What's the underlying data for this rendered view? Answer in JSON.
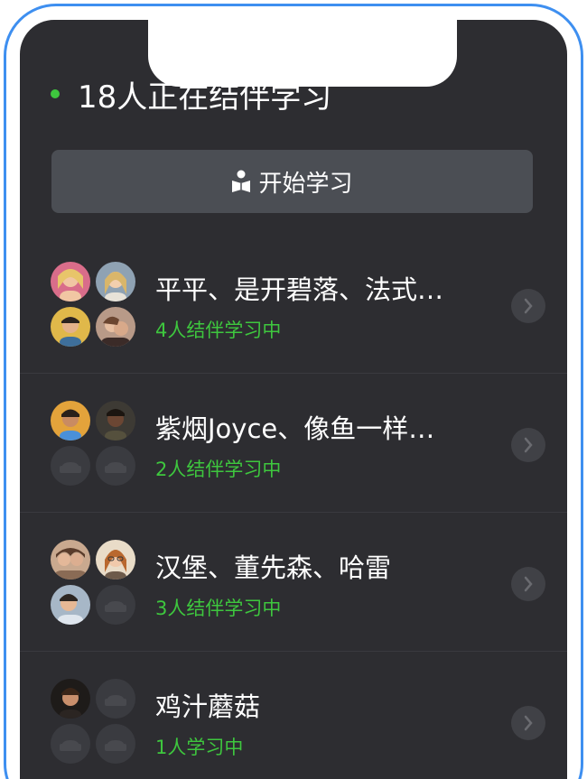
{
  "header": {
    "online_text": "18人正在结伴学习",
    "online_dot_color": "#3ec73e"
  },
  "start_button": {
    "label": "开始学习",
    "icon": "reader-icon"
  },
  "groups": [
    {
      "name": "平平、是开碧落、法式…",
      "status": "4人结伴学习中",
      "avatars": [
        "user-avatar",
        "user-avatar",
        "user-avatar",
        "user-avatar"
      ]
    },
    {
      "name": "紫烟Joyce、像鱼一样…",
      "status": "2人结伴学习中",
      "avatars": [
        "user-avatar",
        "user-avatar",
        "empty-seat",
        "empty-seat"
      ]
    },
    {
      "name": "汉堡、董先森、哈雷",
      "status": "3人结伴学习中",
      "avatars": [
        "user-avatar",
        "user-avatar",
        "user-avatar",
        "empty-seat"
      ]
    },
    {
      "name": "鸡汁蘑菇",
      "status": "1人学习中",
      "avatars": [
        "user-avatar",
        "empty-seat",
        "empty-seat",
        "empty-seat"
      ]
    }
  ],
  "colors": {
    "screen_bg": "#2d2d31",
    "accent_green": "#3ec73e",
    "frame_blue": "#3e8ff0",
    "button_bg": "#4b4e54"
  }
}
